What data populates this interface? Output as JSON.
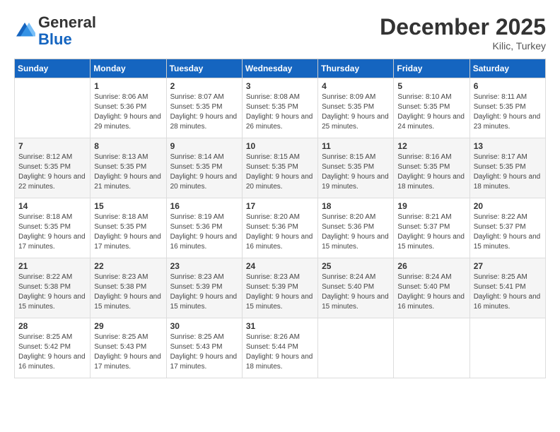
{
  "logo": {
    "text_general": "General",
    "text_blue": "Blue"
  },
  "header": {
    "month": "December 2025",
    "location": "Kilic, Turkey"
  },
  "days_of_week": [
    "Sunday",
    "Monday",
    "Tuesday",
    "Wednesday",
    "Thursday",
    "Friday",
    "Saturday"
  ],
  "weeks": [
    [
      {
        "day": "",
        "sunrise": "",
        "sunset": "",
        "daylight": ""
      },
      {
        "day": "1",
        "sunrise": "Sunrise: 8:06 AM",
        "sunset": "Sunset: 5:36 PM",
        "daylight": "Daylight: 9 hours and 29 minutes."
      },
      {
        "day": "2",
        "sunrise": "Sunrise: 8:07 AM",
        "sunset": "Sunset: 5:35 PM",
        "daylight": "Daylight: 9 hours and 28 minutes."
      },
      {
        "day": "3",
        "sunrise": "Sunrise: 8:08 AM",
        "sunset": "Sunset: 5:35 PM",
        "daylight": "Daylight: 9 hours and 26 minutes."
      },
      {
        "day": "4",
        "sunrise": "Sunrise: 8:09 AM",
        "sunset": "Sunset: 5:35 PM",
        "daylight": "Daylight: 9 hours and 25 minutes."
      },
      {
        "day": "5",
        "sunrise": "Sunrise: 8:10 AM",
        "sunset": "Sunset: 5:35 PM",
        "daylight": "Daylight: 9 hours and 24 minutes."
      },
      {
        "day": "6",
        "sunrise": "Sunrise: 8:11 AM",
        "sunset": "Sunset: 5:35 PM",
        "daylight": "Daylight: 9 hours and 23 minutes."
      }
    ],
    [
      {
        "day": "7",
        "sunrise": "Sunrise: 8:12 AM",
        "sunset": "Sunset: 5:35 PM",
        "daylight": "Daylight: 9 hours and 22 minutes."
      },
      {
        "day": "8",
        "sunrise": "Sunrise: 8:13 AM",
        "sunset": "Sunset: 5:35 PM",
        "daylight": "Daylight: 9 hours and 21 minutes."
      },
      {
        "day": "9",
        "sunrise": "Sunrise: 8:14 AM",
        "sunset": "Sunset: 5:35 PM",
        "daylight": "Daylight: 9 hours and 20 minutes."
      },
      {
        "day": "10",
        "sunrise": "Sunrise: 8:15 AM",
        "sunset": "Sunset: 5:35 PM",
        "daylight": "Daylight: 9 hours and 20 minutes."
      },
      {
        "day": "11",
        "sunrise": "Sunrise: 8:15 AM",
        "sunset": "Sunset: 5:35 PM",
        "daylight": "Daylight: 9 hours and 19 minutes."
      },
      {
        "day": "12",
        "sunrise": "Sunrise: 8:16 AM",
        "sunset": "Sunset: 5:35 PM",
        "daylight": "Daylight: 9 hours and 18 minutes."
      },
      {
        "day": "13",
        "sunrise": "Sunrise: 8:17 AM",
        "sunset": "Sunset: 5:35 PM",
        "daylight": "Daylight: 9 hours and 18 minutes."
      }
    ],
    [
      {
        "day": "14",
        "sunrise": "Sunrise: 8:18 AM",
        "sunset": "Sunset: 5:35 PM",
        "daylight": "Daylight: 9 hours and 17 minutes."
      },
      {
        "day": "15",
        "sunrise": "Sunrise: 8:18 AM",
        "sunset": "Sunset: 5:35 PM",
        "daylight": "Daylight: 9 hours and 17 minutes."
      },
      {
        "day": "16",
        "sunrise": "Sunrise: 8:19 AM",
        "sunset": "Sunset: 5:36 PM",
        "daylight": "Daylight: 9 hours and 16 minutes."
      },
      {
        "day": "17",
        "sunrise": "Sunrise: 8:20 AM",
        "sunset": "Sunset: 5:36 PM",
        "daylight": "Daylight: 9 hours and 16 minutes."
      },
      {
        "day": "18",
        "sunrise": "Sunrise: 8:20 AM",
        "sunset": "Sunset: 5:36 PM",
        "daylight": "Daylight: 9 hours and 15 minutes."
      },
      {
        "day": "19",
        "sunrise": "Sunrise: 8:21 AM",
        "sunset": "Sunset: 5:37 PM",
        "daylight": "Daylight: 9 hours and 15 minutes."
      },
      {
        "day": "20",
        "sunrise": "Sunrise: 8:22 AM",
        "sunset": "Sunset: 5:37 PM",
        "daylight": "Daylight: 9 hours and 15 minutes."
      }
    ],
    [
      {
        "day": "21",
        "sunrise": "Sunrise: 8:22 AM",
        "sunset": "Sunset: 5:38 PM",
        "daylight": "Daylight: 9 hours and 15 minutes."
      },
      {
        "day": "22",
        "sunrise": "Sunrise: 8:23 AM",
        "sunset": "Sunset: 5:38 PM",
        "daylight": "Daylight: 9 hours and 15 minutes."
      },
      {
        "day": "23",
        "sunrise": "Sunrise: 8:23 AM",
        "sunset": "Sunset: 5:39 PM",
        "daylight": "Daylight: 9 hours and 15 minutes."
      },
      {
        "day": "24",
        "sunrise": "Sunrise: 8:23 AM",
        "sunset": "Sunset: 5:39 PM",
        "daylight": "Daylight: 9 hours and 15 minutes."
      },
      {
        "day": "25",
        "sunrise": "Sunrise: 8:24 AM",
        "sunset": "Sunset: 5:40 PM",
        "daylight": "Daylight: 9 hours and 15 minutes."
      },
      {
        "day": "26",
        "sunrise": "Sunrise: 8:24 AM",
        "sunset": "Sunset: 5:40 PM",
        "daylight": "Daylight: 9 hours and 16 minutes."
      },
      {
        "day": "27",
        "sunrise": "Sunrise: 8:25 AM",
        "sunset": "Sunset: 5:41 PM",
        "daylight": "Daylight: 9 hours and 16 minutes."
      }
    ],
    [
      {
        "day": "28",
        "sunrise": "Sunrise: 8:25 AM",
        "sunset": "Sunset: 5:42 PM",
        "daylight": "Daylight: 9 hours and 16 minutes."
      },
      {
        "day": "29",
        "sunrise": "Sunrise: 8:25 AM",
        "sunset": "Sunset: 5:43 PM",
        "daylight": "Daylight: 9 hours and 17 minutes."
      },
      {
        "day": "30",
        "sunrise": "Sunrise: 8:25 AM",
        "sunset": "Sunset: 5:43 PM",
        "daylight": "Daylight: 9 hours and 17 minutes."
      },
      {
        "day": "31",
        "sunrise": "Sunrise: 8:26 AM",
        "sunset": "Sunset: 5:44 PM",
        "daylight": "Daylight: 9 hours and 18 minutes."
      },
      {
        "day": "",
        "sunrise": "",
        "sunset": "",
        "daylight": ""
      },
      {
        "day": "",
        "sunrise": "",
        "sunset": "",
        "daylight": ""
      },
      {
        "day": "",
        "sunrise": "",
        "sunset": "",
        "daylight": ""
      }
    ]
  ]
}
